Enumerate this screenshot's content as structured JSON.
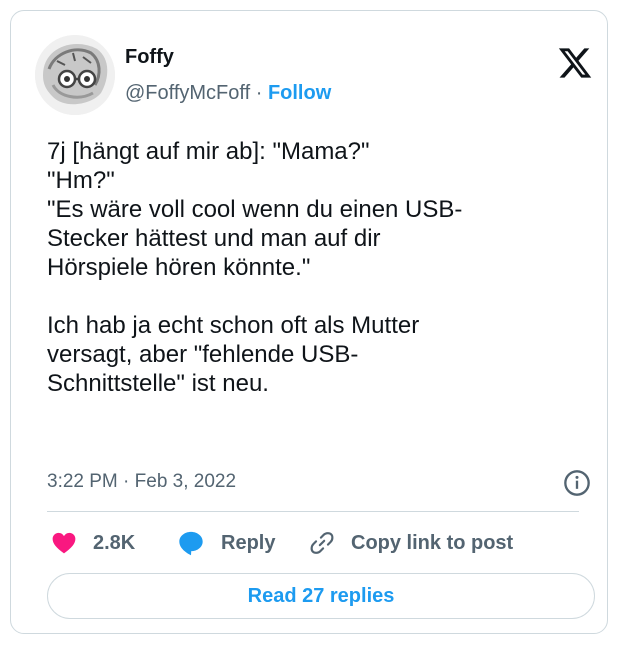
{
  "author": {
    "name": "Foffy",
    "handle": "@FoffyMcFoff",
    "separator": " · ",
    "follow_label": "Follow"
  },
  "tweet": {
    "paragraphs": [
      "7j [hängt auf mir ab]: \"Mama?\"\n\"Hm?\"\n\"Es wäre voll cool wenn du einen USB-\nStecker hättest und man auf dir\nHörspiele hören könnte.\"",
      "Ich hab ja echt schon oft als Mutter\nversagt, aber \"fehlende USB-\nSchnittstelle\" ist neu."
    ],
    "timestamp": "3:22 PM · Feb 3, 2022"
  },
  "actions": {
    "likes": "2.8K",
    "reply_label": "Reply",
    "copy_label": "Copy link to post"
  },
  "read_replies_label": "Read 27 replies",
  "icons": {
    "brand": "x-logo-icon",
    "like": "heart-icon",
    "reply": "speech-bubble-icon",
    "copy": "link-icon",
    "info": "info-icon"
  },
  "colors": {
    "accent": "#1d9bf0",
    "like": "#f91880",
    "muted": "#536471",
    "text": "#0f1419",
    "border": "#cfd9de"
  }
}
